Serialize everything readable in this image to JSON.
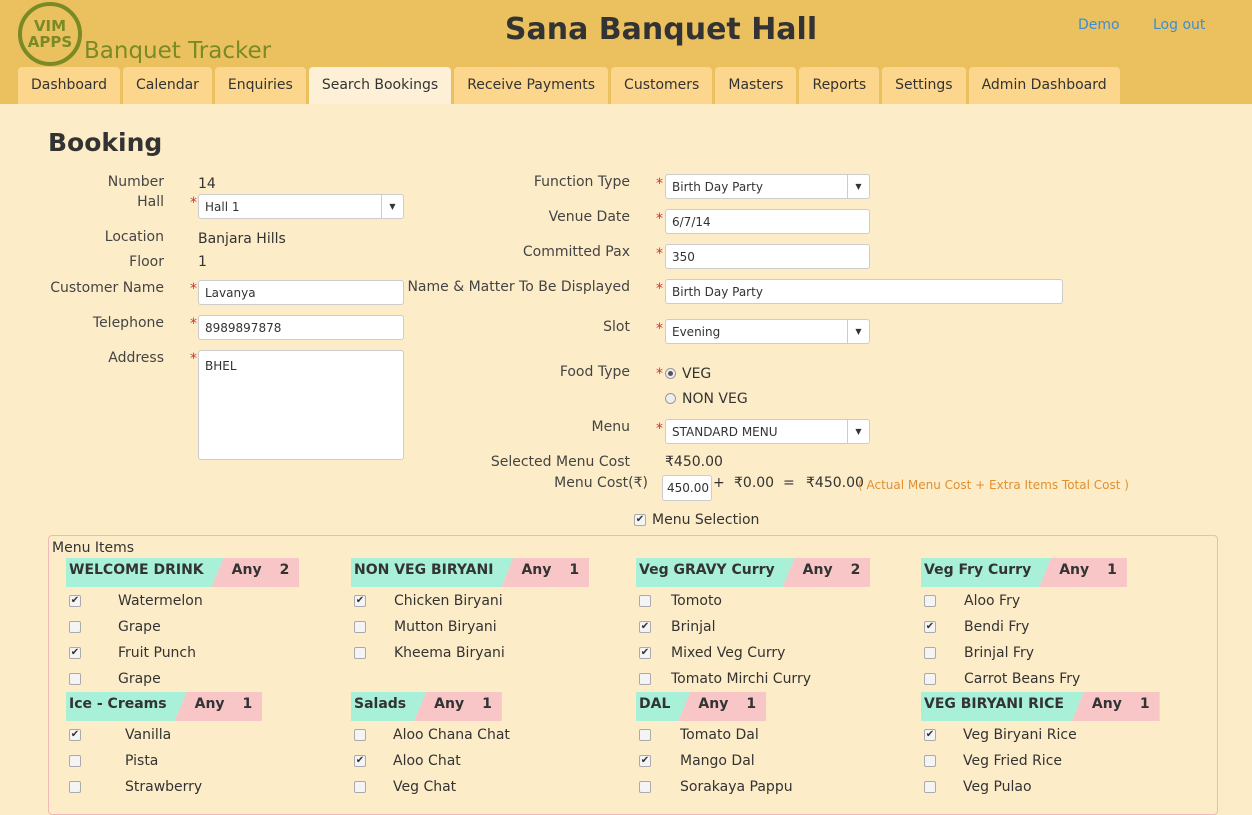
{
  "header": {
    "logo_text": "VIM APPS",
    "brand": "Banquet Tracker",
    "title": "Sana Banquet Hall",
    "links": [
      "Demo",
      "Log out"
    ]
  },
  "tabs": [
    "Dashboard",
    "Calendar",
    "Enquiries",
    "Search Bookings",
    "Receive Payments",
    "Customers",
    "Masters",
    "Reports",
    "Settings",
    "Admin Dashboard"
  ],
  "active_tab": "Search Bookings",
  "page_title": "Booking",
  "left": {
    "number_label": "Number",
    "number": "14",
    "hall_label": "Hall",
    "hall": "Hall 1",
    "location_label": "Location",
    "location": "Banjara Hills",
    "floor_label": "Floor",
    "floor": "1",
    "customer_label": "Customer Name",
    "customer": "Lavanya",
    "telephone_label": "Telephone",
    "telephone": "8989897878",
    "address_label": "Address",
    "address": "BHEL"
  },
  "right": {
    "function_label": "Function Type",
    "function": "Birth Day Party",
    "venue_label": "Venue Date",
    "venue": "6/7/14",
    "pax_label": "Committed Pax",
    "pax": "350",
    "display_label": "Name & Matter To Be Displayed",
    "display": "Birth Day Party",
    "slot_label": "Slot",
    "slot": "Evening",
    "food_label": "Food Type",
    "food_options": [
      "VEG",
      "NON VEG"
    ],
    "food_selected": "VEG",
    "menu_label": "Menu",
    "menu": "STANDARD MENU",
    "smc_label": "Selected Menu Cost",
    "smc": "₹450.00",
    "mc_label": "Menu Cost(₹)",
    "mc": "450.00",
    "plus": "+",
    "extra": "₹0.00",
    "eq": "=",
    "total": "₹450.00",
    "formula": "( Actual Menu Cost  + Extra Items Total Cost )",
    "menu_selection": "Menu Selection"
  },
  "menu_items_label": "Menu Items",
  "groups": [
    {
      "name": "WELCOME DRINK",
      "any": "Any",
      "count": "2",
      "items": [
        [
          "Watermelon",
          true
        ],
        [
          "Grape",
          false
        ],
        [
          "Fruit Punch",
          true
        ],
        [
          "Grape",
          false
        ]
      ]
    },
    {
      "name": "NON VEG BIRYANI",
      "any": "Any",
      "count": "1",
      "items": [
        [
          "Chicken Biryani",
          true
        ],
        [
          "Mutton Biryani",
          false
        ],
        [
          "Kheema Biryani",
          false
        ]
      ]
    },
    {
      "name": "Veg GRAVY Curry",
      "any": "Any",
      "count": "2",
      "items": [
        [
          "Tomoto",
          false
        ],
        [
          "Brinjal",
          true
        ],
        [
          "Mixed Veg Curry",
          true
        ],
        [
          "Tomato Mirchi Curry",
          false
        ]
      ]
    },
    {
      "name": "Veg Fry Curry",
      "any": "Any",
      "count": "1",
      "items": [
        [
          "Aloo Fry",
          false
        ],
        [
          "Bendi Fry",
          true
        ],
        [
          "Brinjal Fry",
          false
        ],
        [
          "Carrot Beans Fry",
          false
        ]
      ]
    },
    {
      "name": "Ice - Creams",
      "any": "Any",
      "count": "1",
      "items": [
        [
          "Vanilla",
          true
        ],
        [
          "Pista",
          false
        ],
        [
          "Strawberry",
          false
        ]
      ]
    },
    {
      "name": "Salads",
      "any": "Any",
      "count": "1",
      "items": [
        [
          "Aloo Chana Chat",
          false
        ],
        [
          "Aloo Chat",
          true
        ],
        [
          "Veg Chat",
          false
        ]
      ]
    },
    {
      "name": "DAL",
      "any": "Any",
      "count": "1",
      "items": [
        [
          "Tomato Dal",
          false
        ],
        [
          "Mango Dal",
          true
        ],
        [
          "Sorakaya Pappu",
          false
        ]
      ]
    },
    {
      "name": "VEG BIRYANI RICE",
      "any": "Any",
      "count": "1",
      "items": [
        [
          "Veg Biryani Rice",
          true
        ],
        [
          "Veg Fried Rice",
          false
        ],
        [
          "Veg Pulao",
          false
        ]
      ]
    }
  ]
}
